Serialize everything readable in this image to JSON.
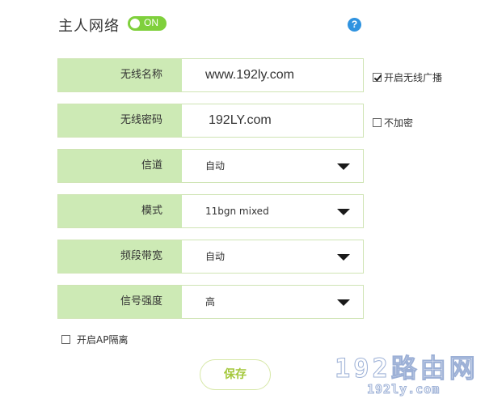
{
  "header": {
    "title": "主人网络",
    "toggle_label": "ON",
    "help_label": "?"
  },
  "fields": {
    "ssid": {
      "label": "无线名称",
      "value": "www.192ly.com"
    },
    "password": {
      "label": "无线密码",
      "value": "192LY.com"
    },
    "channel": {
      "label": "信道",
      "value": "自动"
    },
    "mode": {
      "label": "模式",
      "value": "11bgn mixed"
    },
    "bandwidth": {
      "label": "频段带宽",
      "value": "自动"
    },
    "signal": {
      "label": "信号强度",
      "value": "高"
    }
  },
  "options": {
    "broadcast": {
      "label": "开启无线广播",
      "checked": true
    },
    "no_encrypt": {
      "label": "不加密",
      "checked": false
    },
    "ap_isolation": {
      "label": "开启AP隔离",
      "checked": false
    }
  },
  "actions": {
    "save_label": "保存"
  },
  "watermark": {
    "main": "192路由网",
    "sub": "192ly.com"
  },
  "colors": {
    "accent_green": "#7fd03c",
    "label_bg": "#cdeab5",
    "help_blue": "#2f93e0"
  }
}
